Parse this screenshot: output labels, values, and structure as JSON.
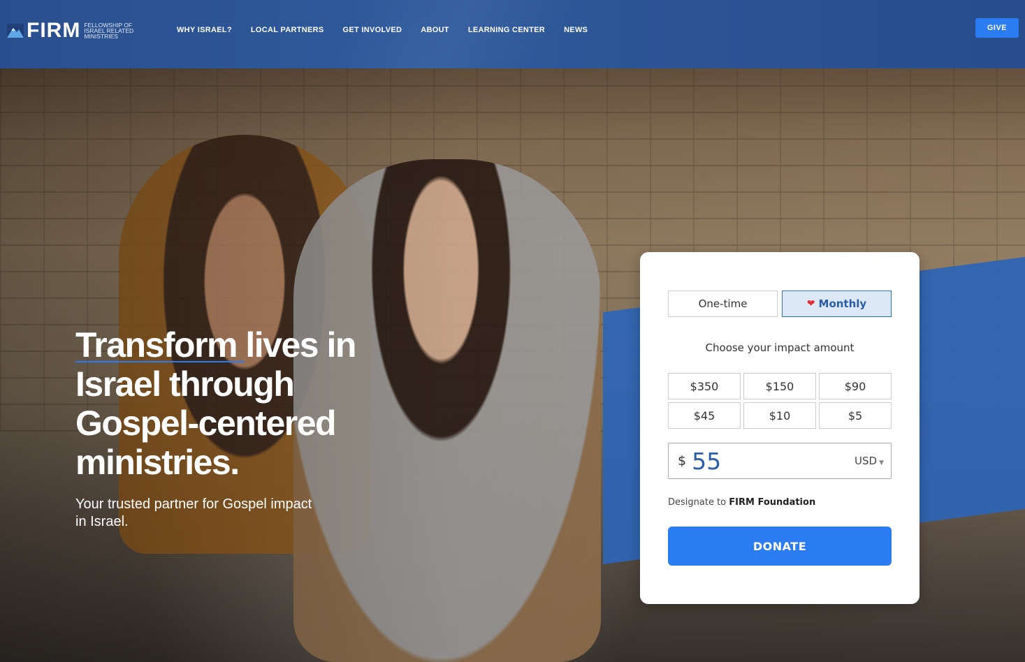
{
  "brand": {
    "name": "FIRM",
    "subtitle": "Fellowship of Israel Related Ministries"
  },
  "nav": {
    "items": [
      {
        "label": "WHY ISRAEL?"
      },
      {
        "label": "LOCAL PARTNERS"
      },
      {
        "label": "GET INVOLVED"
      },
      {
        "label": "ABOUT"
      },
      {
        "label": "LEARNING CENTER"
      },
      {
        "label": "NEWS"
      }
    ],
    "give_label": "GIVE"
  },
  "hero": {
    "title": "Transform lives in Israel through Gospel-centered ministries.",
    "subtitle": "Your trusted partner for Gospel impact in Israel."
  },
  "donation": {
    "frequency": {
      "one_time": "One-time",
      "monthly": "Monthly",
      "selected": "Monthly"
    },
    "impact_label": "Choose your impact amount",
    "amounts": [
      "$350",
      "$150",
      "$90",
      "$45",
      "$10",
      "$5"
    ],
    "currency_symbol": "$",
    "amount_value": "55",
    "currency": "USD",
    "designate_prefix": "Designate to",
    "designate_target": "FIRM Foundation",
    "donate_label": "DONATE"
  },
  "colors": {
    "nav_bg": "#2f5a9c",
    "accent": "#2b7bf1",
    "monthly_bg": "#dde8f6",
    "heart": "#e0303a"
  }
}
